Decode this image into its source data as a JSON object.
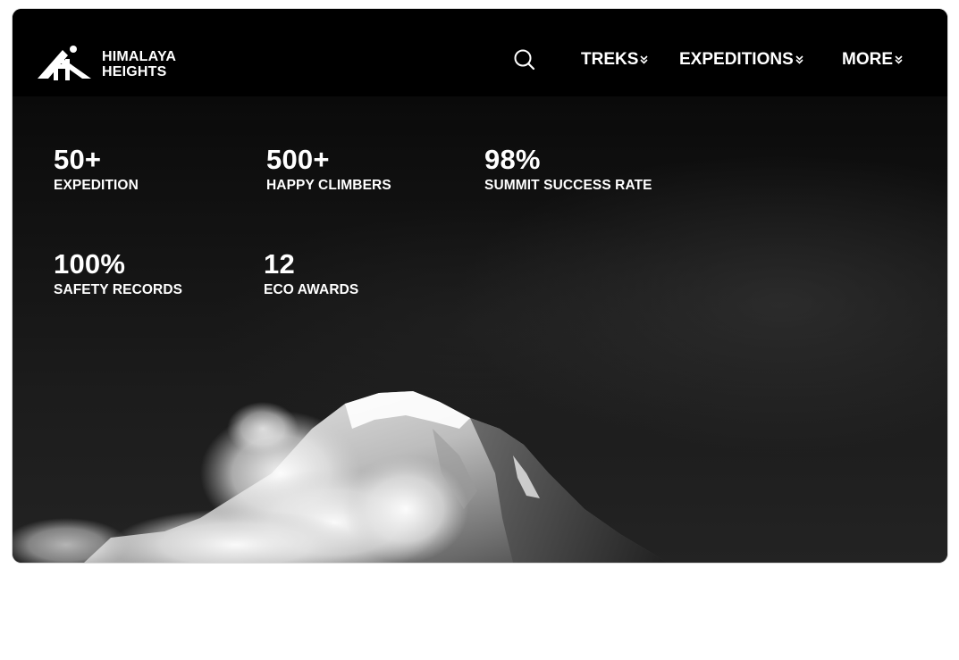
{
  "brand": {
    "line1": "HIMALAYA",
    "line2": "HEIGHTS",
    "logo_icon": "mountain-figure-logo"
  },
  "nav": {
    "search_icon": "search-icon",
    "items": [
      {
        "label": "TREKS",
        "icon": "chevron-down-icon"
      },
      {
        "label": "EXPEDITIONS",
        "icon": "chevron-down-icon"
      },
      {
        "label": "MORE",
        "icon": "chevron-down-icon"
      }
    ]
  },
  "stats": [
    {
      "value": "50+",
      "label": "EXPEDITION"
    },
    {
      "value": "500+",
      "label": "HAPPY CLIMBERS"
    },
    {
      "value": "98%",
      "label": "SUMMIT SUCCESS RATE"
    },
    {
      "value": "100%",
      "label": "SAFETY RECORDS"
    },
    {
      "value": "12",
      "label": "ECO AWARDS"
    }
  ],
  "colors": {
    "background": "#000000",
    "text": "#ffffff",
    "page": "#ffffff"
  }
}
